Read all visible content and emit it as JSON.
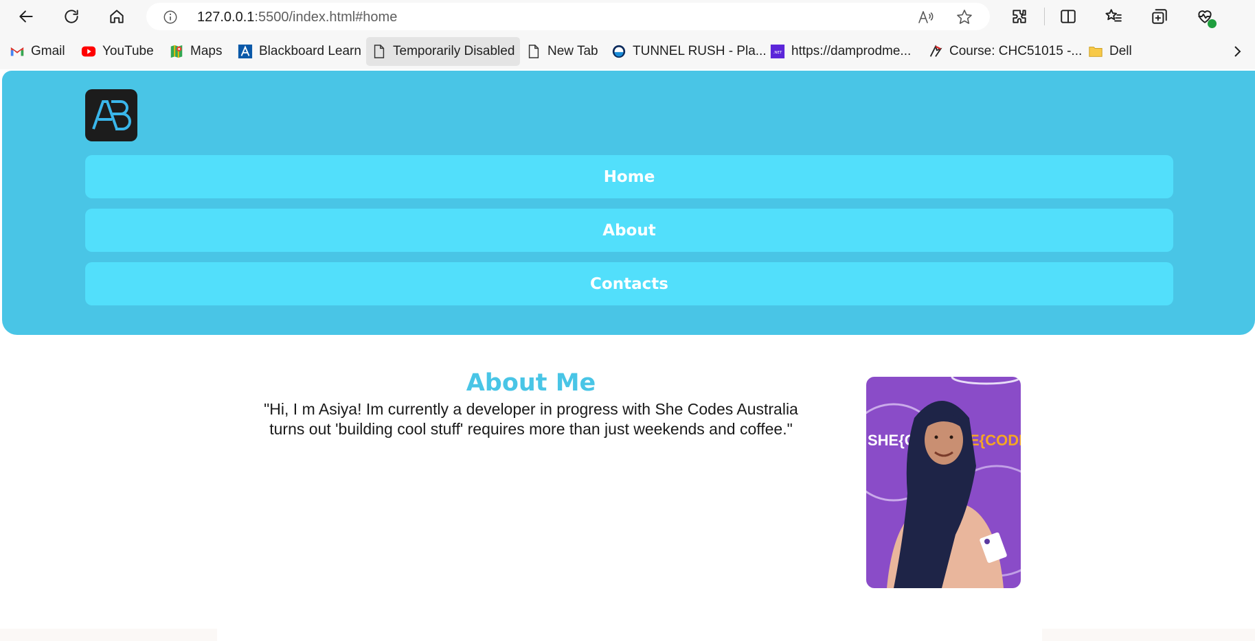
{
  "browser": {
    "url_host": "127.0.0.1",
    "url_rest": ":5500/index.html#home",
    "bookmarks": [
      {
        "label": "Gmail",
        "icon": "gmail-icon"
      },
      {
        "label": "YouTube",
        "icon": "youtube-icon"
      },
      {
        "label": "Maps",
        "icon": "maps-icon"
      },
      {
        "label": "Blackboard Learn",
        "icon": "blackboard-icon"
      },
      {
        "label": "Temporarily Disabled",
        "icon": "page-icon"
      },
      {
        "label": "New Tab",
        "icon": "page-icon"
      },
      {
        "label": "TUNNEL RUSH - Pla...",
        "icon": "tunnel-rush-icon"
      },
      {
        "label": "https://damprodme...",
        "icon": "dotnet-icon"
      },
      {
        "label": "Course: CHC51015 -...",
        "icon": "course-icon"
      },
      {
        "label": "Dell",
        "icon": "folder-icon"
      }
    ]
  },
  "site": {
    "logo_text": "AB",
    "nav": [
      {
        "label": "Home"
      },
      {
        "label": "About"
      },
      {
        "label": "Contacts"
      }
    ],
    "about": {
      "title": "About Me",
      "line1": "\"Hi, I m Asiya! Im currently a developer in progress with She Codes Australia",
      "line2": "turns out 'building cool stuff' requires more than just weekends and coffee.\""
    },
    "photo_banner_text_left": "SHE{COD",
    "photo_banner_text_right": "E{CODES}"
  },
  "colors": {
    "header_bg": "#49c5e6",
    "nav_bg": "#52dffb",
    "title_color": "#49c5e6",
    "photo_bg": "#8a4cc8"
  }
}
